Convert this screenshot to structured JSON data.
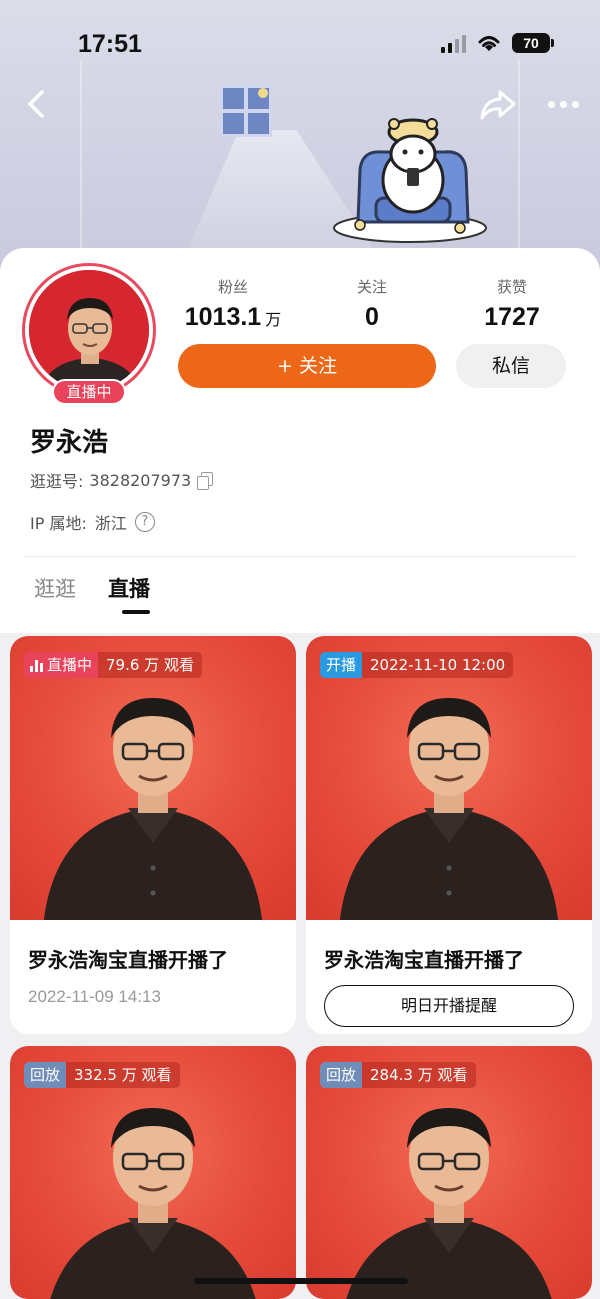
{
  "status_bar": {
    "time": "17:51",
    "battery": "70"
  },
  "profile": {
    "name": "罗永浩",
    "live_badge": "直播中",
    "uid_label": "逛逛号:",
    "uid": "3828207973",
    "ip_label": "IP 属地:",
    "ip_location": "浙江",
    "help_symbol": "?",
    "stats": [
      {
        "label": "粉丝",
        "value": "1013.1",
        "unit": "万"
      },
      {
        "label": "关注",
        "value": "0"
      },
      {
        "label": "获赞",
        "value": "1727"
      }
    ],
    "follow_label": "+ 关注",
    "message_label": "私信"
  },
  "tabs": [
    {
      "label": "逛逛",
      "active": false
    },
    {
      "label": "直播",
      "active": true
    }
  ],
  "cards": [
    {
      "tag": "直播中",
      "info": "79.6 万 观看",
      "tag_type": "live",
      "title": "罗永浩淘宝直播开播了",
      "date": "2022-11-09 14:13"
    },
    {
      "tag": "开播",
      "info": "2022-11-10 12:00",
      "tag_type": "open",
      "title": "罗永浩淘宝直播开播了",
      "button": "明日开播提醒"
    },
    {
      "tag": "回放",
      "info": "332.5 万 观看",
      "tag_type": "replay"
    },
    {
      "tag": "回放",
      "info": "284.3 万 观看",
      "tag_type": "replay"
    }
  ],
  "colors": {
    "accent_orange": "#ec6718",
    "live_red": "#e8435a",
    "open_blue": "#2a9ae0",
    "replay_blue": "#6f8db8",
    "card_bg_red": "#e54a3a"
  },
  "icons": [
    "back-icon",
    "share-icon",
    "more-icon",
    "copy-icon",
    "help-icon",
    "signal-icon",
    "wifi-icon",
    "battery-icon",
    "live-bars-icon"
  ]
}
